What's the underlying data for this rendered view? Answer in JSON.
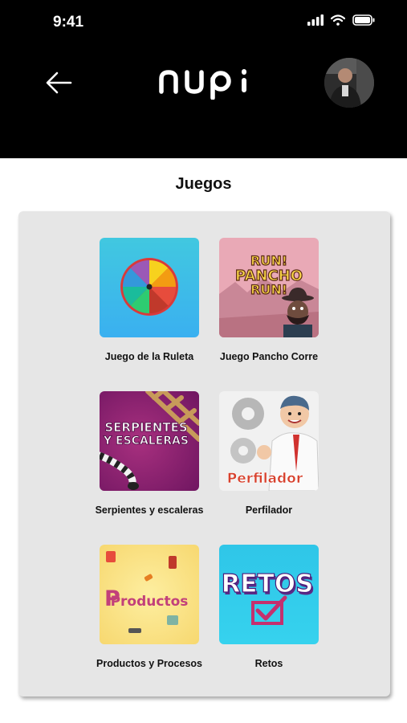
{
  "status_bar": {
    "time": "9:41"
  },
  "header": {
    "logo_text": "nupi"
  },
  "page": {
    "title": "Juegos"
  },
  "games": [
    {
      "label": "Juego de la Ruleta",
      "icon": "roulette-wheel-icon"
    },
    {
      "label": "Juego Pancho Corre",
      "thumb_text": [
        "RUN!",
        "PANCHO",
        "RUN!"
      ]
    },
    {
      "label": "Serpientes y escaleras",
      "thumb_text": [
        "SERPIENTES",
        "Y ESCALERAS"
      ]
    },
    {
      "label": "Perfilador",
      "thumb_text": "Perfilador"
    },
    {
      "label": "Productos y Procesos",
      "thumb_text": "Productos"
    },
    {
      "label": "Retos",
      "thumb_text": "RETOS"
    }
  ],
  "colors": {
    "header_bg": "#000000",
    "card_bg": "#e6e6e6",
    "accent_cyan": "#3cc4e0",
    "accent_purple": "#7a1f7a"
  }
}
